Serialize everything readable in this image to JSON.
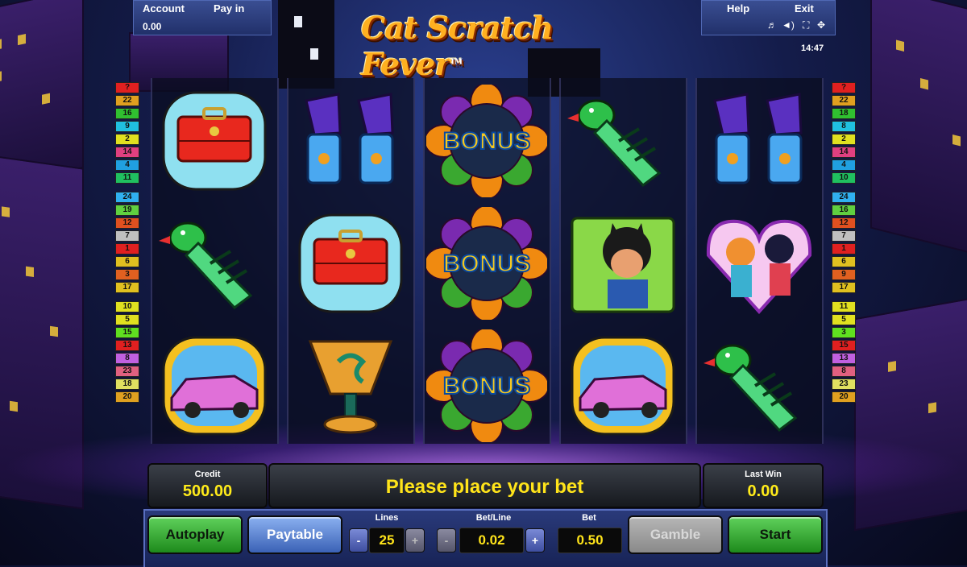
{
  "game": {
    "title": "Cat Scratch Fever",
    "trademark": "TM"
  },
  "top_left": {
    "account_label": "Account",
    "paytable_link": "Pay in",
    "balance": "0.00"
  },
  "top_right": {
    "help_label": "Help",
    "exit_label": "Exit",
    "clock": "14:47",
    "icons": [
      "music-note-icon",
      "sound-icon",
      "fullscreen-icon",
      "settings-icon"
    ],
    "icon_glyphs": [
      "♬",
      "◄)",
      "⛶",
      "✥"
    ]
  },
  "reels": [
    [
      "briefcase",
      "pet-parrot-comb",
      "pink-cadillac"
    ],
    [
      "platform-shoes",
      "briefcase",
      "golden-cup"
    ],
    [
      "bonus",
      "bonus",
      "bonus"
    ],
    [
      "pet-parrot-comb",
      "cat-portrait",
      "pink-cadillac"
    ],
    [
      "platform-shoes",
      "cat-ladies-heart",
      "pet-parrot-comb"
    ]
  ],
  "bonus_text": "BONUS",
  "lines_left": [
    "?",
    "22",
    "16",
    "9",
    "2",
    "14",
    "4",
    "11",
    "24",
    "19",
    "12",
    "7",
    "1",
    "6",
    "3",
    "17",
    "10",
    "5",
    "15",
    "13",
    "8",
    "23",
    "18",
    "20"
  ],
  "lines_right": [
    "?",
    "22",
    "18",
    "8",
    "2",
    "14",
    "4",
    "10",
    "24",
    "16",
    "12",
    "7",
    "1",
    "6",
    "9",
    "17",
    "11",
    "5",
    "3",
    "15",
    "13",
    "8",
    "23",
    "20"
  ],
  "line_colors": [
    "#e02020",
    "#e0a020",
    "#30c030",
    "#20c0e0",
    "#e0e020",
    "#e04080",
    "#20a0e0",
    "#20c060",
    "#30b0f0",
    "#60d040",
    "#e05020",
    "#c0c0c0",
    "#e02020",
    "#e0c020",
    "#e06020",
    "#e0c020",
    "#e0e020",
    "#e0e020",
    "#60e020",
    "#e02020",
    "#c060e0",
    "#e06080",
    "#e0e060",
    "#e0a020"
  ],
  "credit": {
    "label": "Credit",
    "value": "500.00"
  },
  "message": "Please place your bet",
  "last_win": {
    "label": "Last Win",
    "value": "0.00"
  },
  "controls": {
    "autoplay_label": "Autoplay",
    "paytable_label": "Paytable",
    "lines_label": "Lines",
    "lines_value": "25",
    "betline_label": "Bet/Line",
    "betline_value": "0.02",
    "bet_label": "Bet",
    "bet_value": "0.50",
    "gamble_label": "Gamble",
    "start_label": "Start",
    "minus": "-",
    "plus": "+"
  }
}
